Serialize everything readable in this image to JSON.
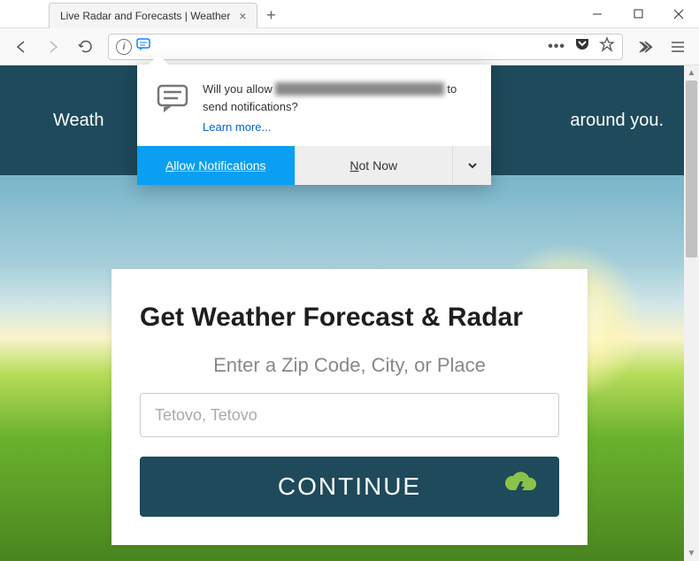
{
  "tab": {
    "title": "Live Radar and Forecasts | Weather"
  },
  "notification": {
    "prefix": "Will you allow ",
    "domain_blurred": "localweatherforecasttracker.com",
    "suffix": " to send notifications?",
    "learn_more": "Learn more...",
    "allow": "Allow Notifications",
    "not_now_underline": "N",
    "not_now_rest": "ot Now"
  },
  "page": {
    "banner_left": "Weath",
    "banner_right": "around you.",
    "card_title": "Get Weather Forecast & Radar",
    "card_subtitle": "Enter a Zip Code, City, or Place",
    "search_placeholder": "Tetovo, Tetovo",
    "continue_label": "CONTINUE"
  },
  "colors": {
    "banner": "#1e4a5c",
    "continue_btn": "#1e4a5c",
    "allow_btn": "#0a9ff2",
    "accent_green": "#8bc34a"
  }
}
